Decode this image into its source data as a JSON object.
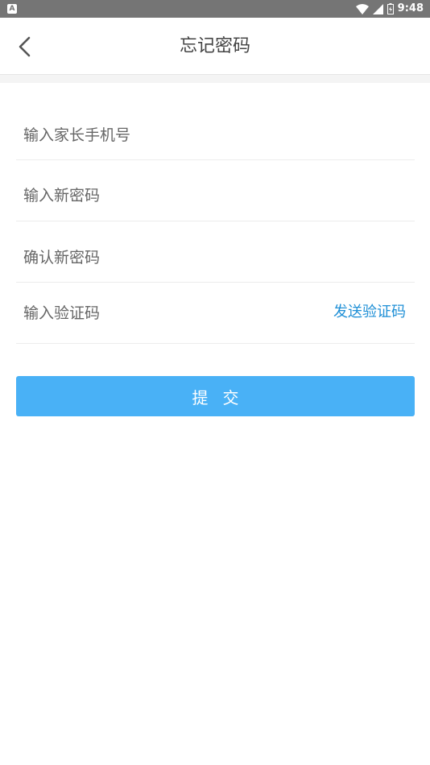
{
  "status_bar": {
    "time": "9:48",
    "app_icon_letter": "A"
  },
  "header": {
    "title": "忘记密码",
    "back_icon": "chevron-left-icon"
  },
  "form": {
    "phone_placeholder": "输入家长手机号",
    "new_password_placeholder": "输入新密码",
    "confirm_password_placeholder": "确认新密码",
    "code_placeholder": "输入验证码",
    "send_code_label": "发送验证码",
    "submit_label": "提交"
  },
  "colors": {
    "accent": "#49b1f6",
    "link": "#1e8fd6",
    "status_bar": "#757575"
  }
}
